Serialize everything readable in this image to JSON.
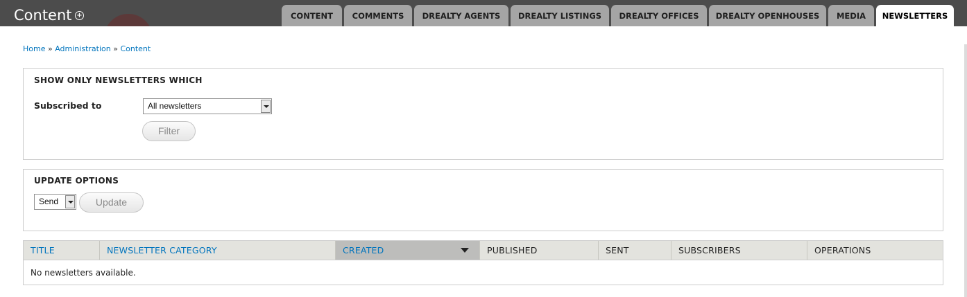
{
  "header": {
    "title": "Content",
    "shortcut_icon": "plus-circle-icon",
    "tabs": [
      {
        "label": "CONTENT",
        "active": false
      },
      {
        "label": "COMMENTS",
        "active": false
      },
      {
        "label": "DREALTY AGENTS",
        "active": false
      },
      {
        "label": "DREALTY LISTINGS",
        "active": false
      },
      {
        "label": "DREALTY OFFICES",
        "active": false
      },
      {
        "label": "DREALTY OPENHOUSES",
        "active": false
      },
      {
        "label": "MEDIA",
        "active": false
      },
      {
        "label": "NEWSLETTERS",
        "active": true
      }
    ]
  },
  "breadcrumb": {
    "items": [
      "Home",
      "Administration",
      "Content"
    ],
    "separator": "»"
  },
  "filter": {
    "legend": "SHOW ONLY NEWSLETTERS WHICH",
    "subscribed_label": "Subscribed to",
    "subscribed_value": "All newsletters",
    "filter_button": "Filter"
  },
  "update": {
    "legend": "UPDATE OPTIONS",
    "action_value": "Send",
    "update_button": "Update"
  },
  "table": {
    "columns": [
      {
        "label": "TITLE",
        "sortable": true
      },
      {
        "label": "NEWSLETTER CATEGORY",
        "sortable": true
      },
      {
        "label": "CREATED",
        "sortable": true,
        "sorted": "desc"
      },
      {
        "label": "PUBLISHED",
        "sortable": false
      },
      {
        "label": "SENT",
        "sortable": false
      },
      {
        "label": "SUBSCRIBERS",
        "sortable": false
      },
      {
        "label": "OPERATIONS",
        "sortable": false
      }
    ],
    "empty_message": "No newsletters available."
  },
  "colors": {
    "header_bg": "#4c4c4c",
    "tab_bg": "#a5a5a5",
    "link": "#0074bd",
    "table_head_bg": "#e3e3de",
    "sorted_col_bg": "#bdbdbb"
  }
}
